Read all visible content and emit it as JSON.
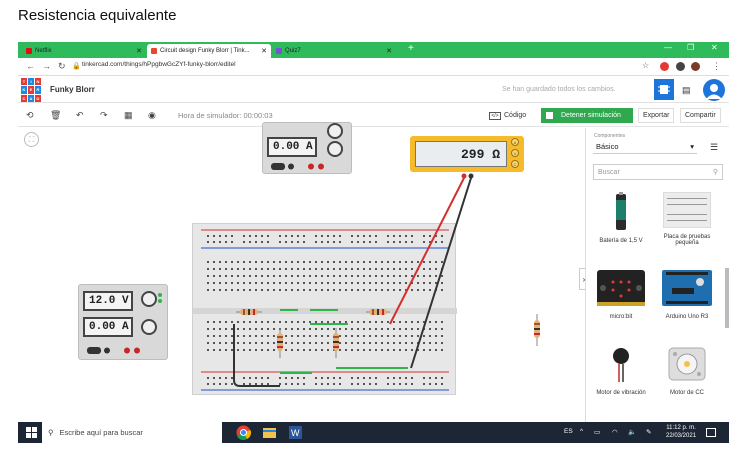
{
  "doc_title": "Resistencia equivalente",
  "browser": {
    "tabs": [
      {
        "label": "Netflix",
        "active": false,
        "favicon_color": "#e50914"
      },
      {
        "label": "Circuit design Funky Blorr | Tink...",
        "active": true,
        "favicon_color": "#e8492e"
      },
      {
        "label": "Quiz7",
        "active": false,
        "favicon_color": "#7b4fd6"
      }
    ],
    "url": "tinkercad.com/things/hPpgbwGcZYf-funky-blorr/editel"
  },
  "header": {
    "logo_letters": [
      "TIN",
      "KER",
      "CAD"
    ],
    "project_name": "Funky Blorr",
    "saved_status": "Se han guardado todos los cambios."
  },
  "toolbar": {
    "sim_time": "Hora de simulador: 00:00:03",
    "code_label": "Código",
    "stop_label": "Detener simulación",
    "export_label": "Exportar",
    "share_label": "Compartir"
  },
  "circuit": {
    "top_psu_current": "0.00 A",
    "psu_voltage": "12.0 V",
    "psu_current": "0.00 A",
    "multimeter_reading": "299 Ω",
    "bb_row_letters_top": [
      "j",
      "i",
      "h",
      "g",
      "f"
    ],
    "bb_row_letters_bottom": [
      "e",
      "d",
      "c",
      "b",
      "a"
    ],
    "resistor_value_series": [],
    "color_red_wire": "#d32f2f",
    "color_black_wire": "#333333",
    "color_green_link": "#2fb44a"
  },
  "panel": {
    "category_label": "Componentes",
    "category_value": "Básico",
    "search_placeholder": "Buscar",
    "components": [
      {
        "label": "Batería de 1,5 V",
        "icon": "battery-icon"
      },
      {
        "label": "Placa de pruebas pequeña",
        "icon": "breadboard-icon"
      },
      {
        "label": "micro:bit",
        "icon": "microbit-icon"
      },
      {
        "label": "Arduino Uno R3",
        "icon": "arduino-icon"
      },
      {
        "label": "Motor de vibración",
        "icon": "vibration-motor-icon"
      },
      {
        "label": "Motor de CC",
        "icon": "dc-motor-icon"
      }
    ]
  },
  "taskbar": {
    "search_placeholder": "Escribe aquí para buscar",
    "lang": "ES",
    "time": "11:12 p. m.",
    "date": "22/03/2021"
  }
}
